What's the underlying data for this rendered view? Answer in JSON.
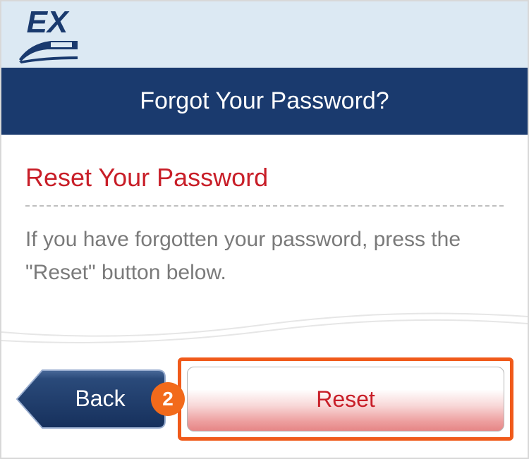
{
  "header": {
    "logo_text": "EX",
    "title": "Forgot Your Password?"
  },
  "content": {
    "subtitle": "Reset Your Password",
    "description": "If you have forgotten your password, press the \"Reset\" button below."
  },
  "buttons": {
    "back_label": "Back",
    "reset_label": "Reset"
  },
  "badge": {
    "number": "2"
  }
}
